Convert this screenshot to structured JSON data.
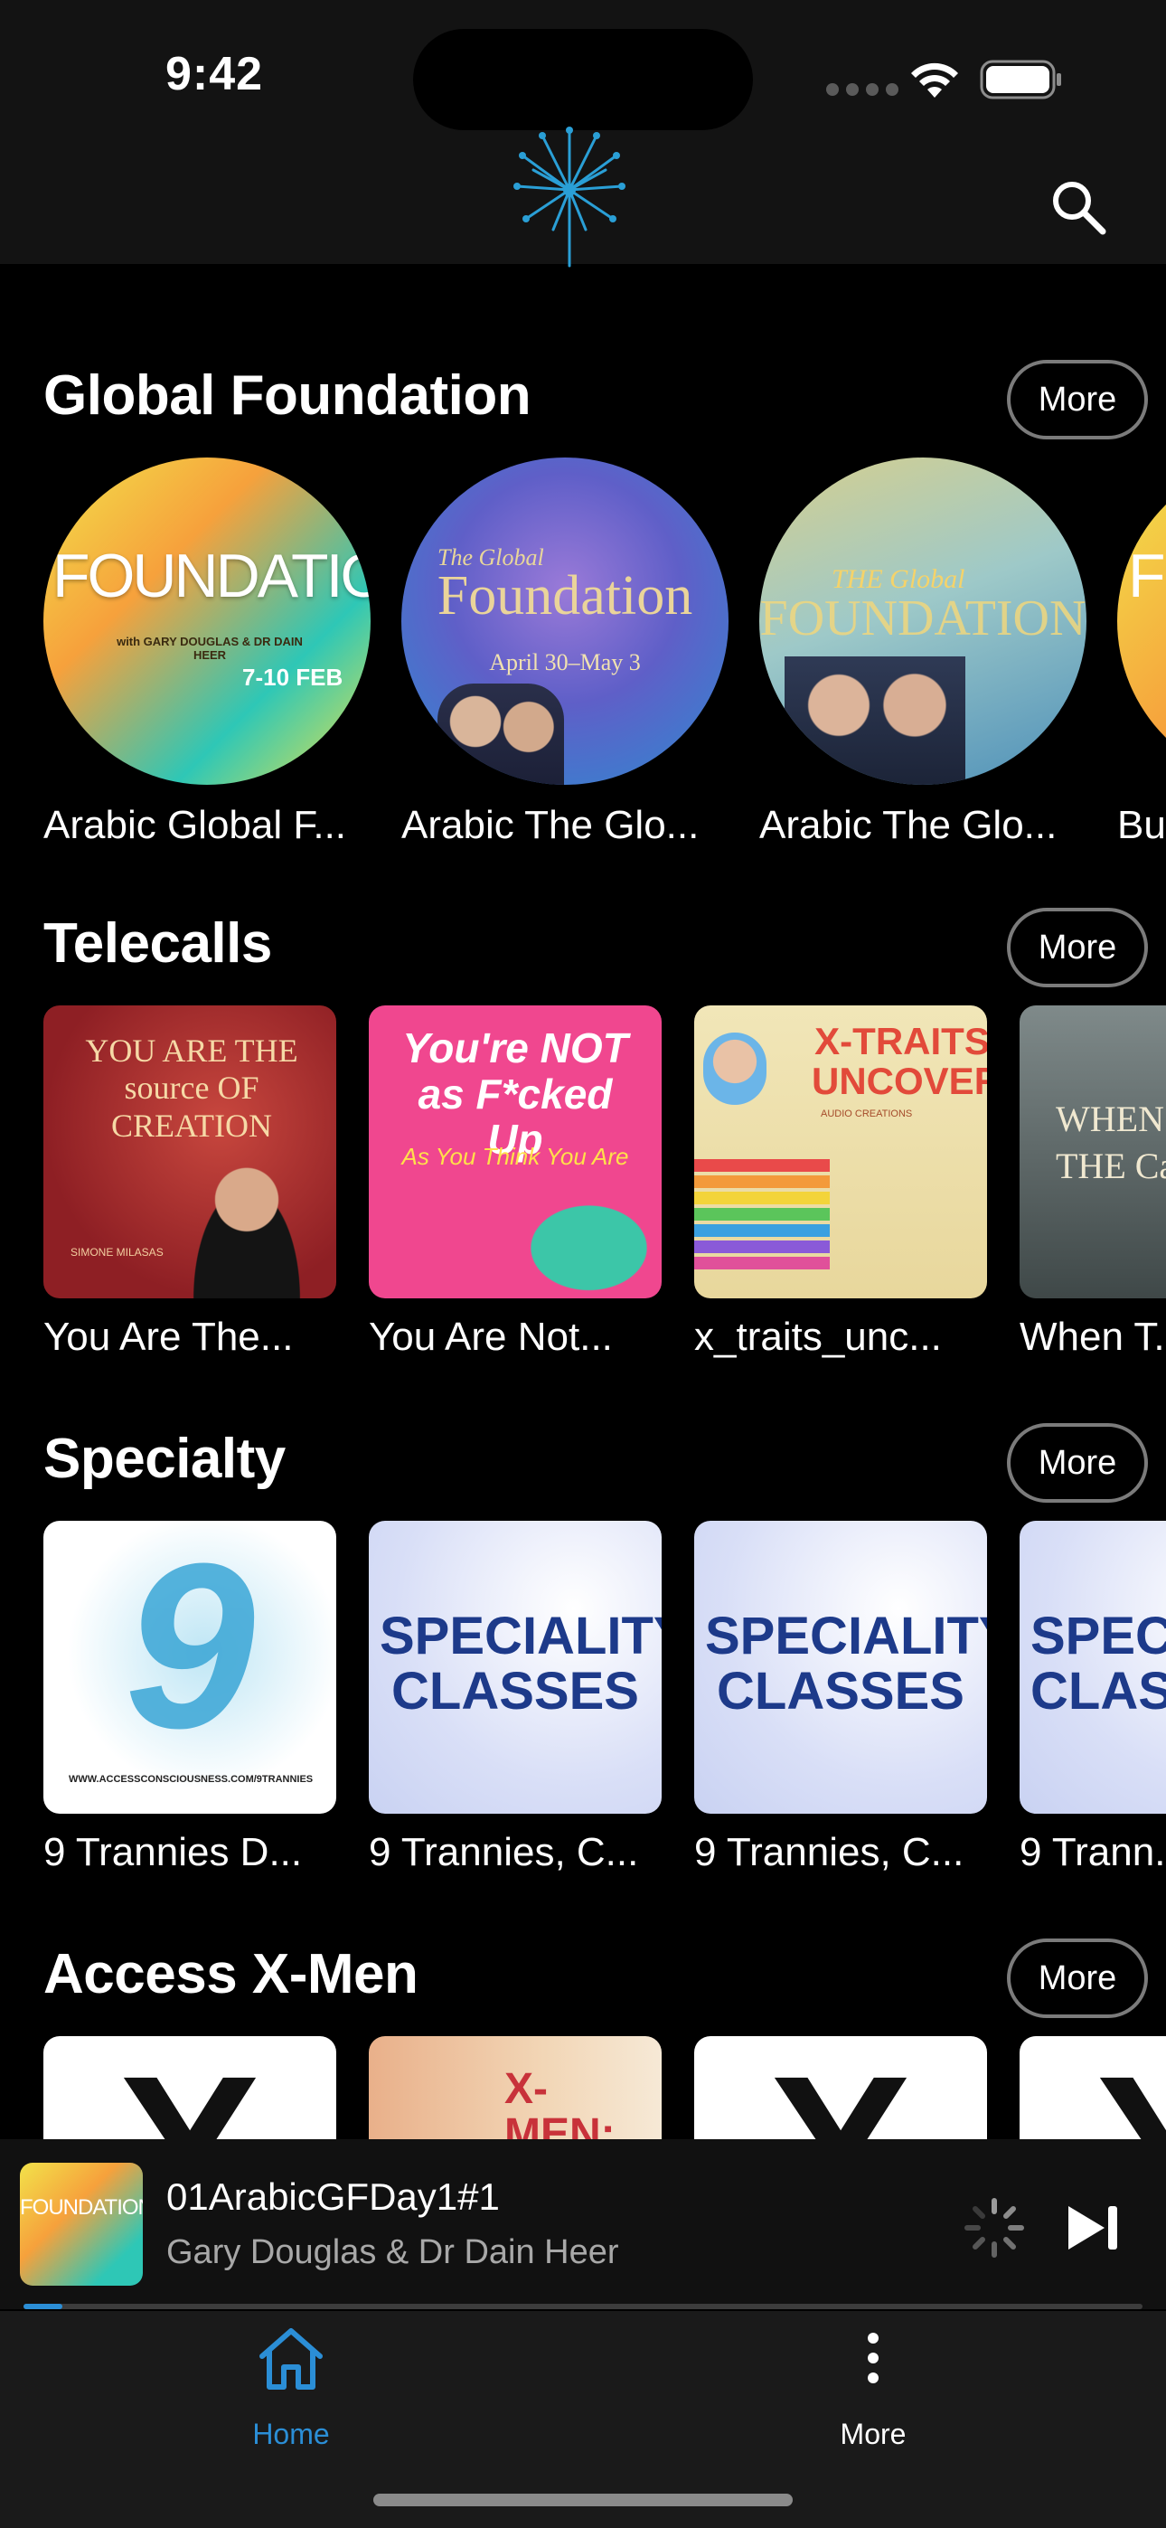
{
  "status_bar": {
    "time": "9:42"
  },
  "header": {
    "logo_icon": "dandelion-logo-icon",
    "search_icon": "search-icon",
    "accent": "#2a9fd6"
  },
  "sections": [
    {
      "title": "Global Foundation",
      "more_label": "More",
      "items": [
        {
          "caption": "Arabic Global F...",
          "art_text": "FOUNDATION",
          "art_sub": "with GARY DOUGLAS & DR DAIN HEER",
          "art_date": "7-10 FEB"
        },
        {
          "caption": "Arabic The Glo...",
          "art_text": "Foundation",
          "art_sub": "The Global",
          "art_date": "April 30–May 3"
        },
        {
          "caption": "Arabic The Glo...",
          "art_text": "FOUNDATION",
          "art_sub": "THE Global",
          "art_date": ""
        },
        {
          "caption": "Bu...",
          "art_text": "F",
          "art_sub": "",
          "art_date": ""
        }
      ]
    },
    {
      "title": "Telecalls",
      "more_label": "More",
      "items": [
        {
          "caption": "You Are The...",
          "art_text": "YOU ARE THE source OF CREATION",
          "art_sub": "SIMONE MILASAS"
        },
        {
          "caption": "You Are Not...",
          "art_text": "You're NOT as F*cked Up",
          "art_sub": "As You Think You Are"
        },
        {
          "caption": "x_traits_unc...",
          "art_text": "X-TRAITS UNCOVERED",
          "art_sub": "AUDIO CREATIONS"
        },
        {
          "caption": "When T...",
          "art_text": "WHEN THE Cal",
          "art_sub": ""
        }
      ]
    },
    {
      "title": "Specialty",
      "more_label": "More",
      "items": [
        {
          "caption": "9 Trannies D...",
          "art_text": "9",
          "art_sub": "WWW.ACCESSCONSCIOUSNESS.COM/9TRANNIES"
        },
        {
          "caption": "9 Trannies, C...",
          "art_text": "SPECIALITY CLASSES",
          "art_sub": ""
        },
        {
          "caption": "9 Trannies, C...",
          "art_text": "SPECIALITY CLASSES",
          "art_sub": ""
        },
        {
          "caption": "9 Trann...",
          "art_text": "SPECI CLAS",
          "art_sub": ""
        }
      ]
    },
    {
      "title": "Access X-Men",
      "more_label": "More",
      "items": [
        {
          "caption": "",
          "art_text": "X"
        },
        {
          "caption": "",
          "art_text": "X-MEN: CREATING THE"
        },
        {
          "caption": "",
          "art_text": "X"
        },
        {
          "caption": "",
          "art_text": "X"
        }
      ]
    }
  ],
  "mini_player": {
    "title": "01ArabicGFDay1#1",
    "artist": "Gary Douglas & Dr Dain Heer",
    "art_text": "FOUNDATION",
    "progress": 0.035,
    "loading_icon": "loading-spinner-icon",
    "next_icon": "skip-next-icon"
  },
  "tab_bar": {
    "tabs": [
      {
        "label": "Home",
        "icon": "home-icon",
        "active": true,
        "color": "#2b8ed6"
      },
      {
        "label": "More",
        "icon": "more-vertical-icon",
        "active": false,
        "color": "#ffffff"
      }
    ]
  }
}
